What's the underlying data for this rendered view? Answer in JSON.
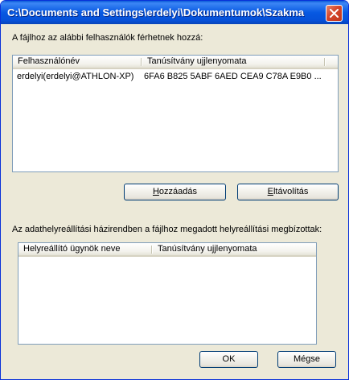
{
  "window": {
    "title": "C:\\Documents and Settings\\erdelyi\\Dokumentumok\\Szakmai a..."
  },
  "users_section": {
    "label": "A fájlhoz az alábbi felhasználók férhetnek hozzá:",
    "columns": [
      "Felhasználónév",
      "Tanúsítvány ujjlenyomata"
    ],
    "rows": [
      {
        "user": "erdelyi(erdelyi@ATHLON-XP)",
        "thumbprint": "6FA6 B825 5ABF 6AED CEA9 C78A E9B0 ..."
      }
    ],
    "add_button": {
      "pre": "",
      "accel": "H",
      "post": "ozzáadás"
    },
    "remove_button": {
      "pre": "",
      "accel": "E",
      "post": "ltávolítás"
    }
  },
  "recovery_section": {
    "label": "Az adathelyreállítási házirendben a fájlhoz megadott helyreállítási megbízottak:",
    "columns": [
      "Helyreállító ügynök neve",
      "Tanúsítvány ujjlenyomata"
    ]
  },
  "footer": {
    "ok_label": "OK",
    "cancel_label": "Mégse"
  }
}
